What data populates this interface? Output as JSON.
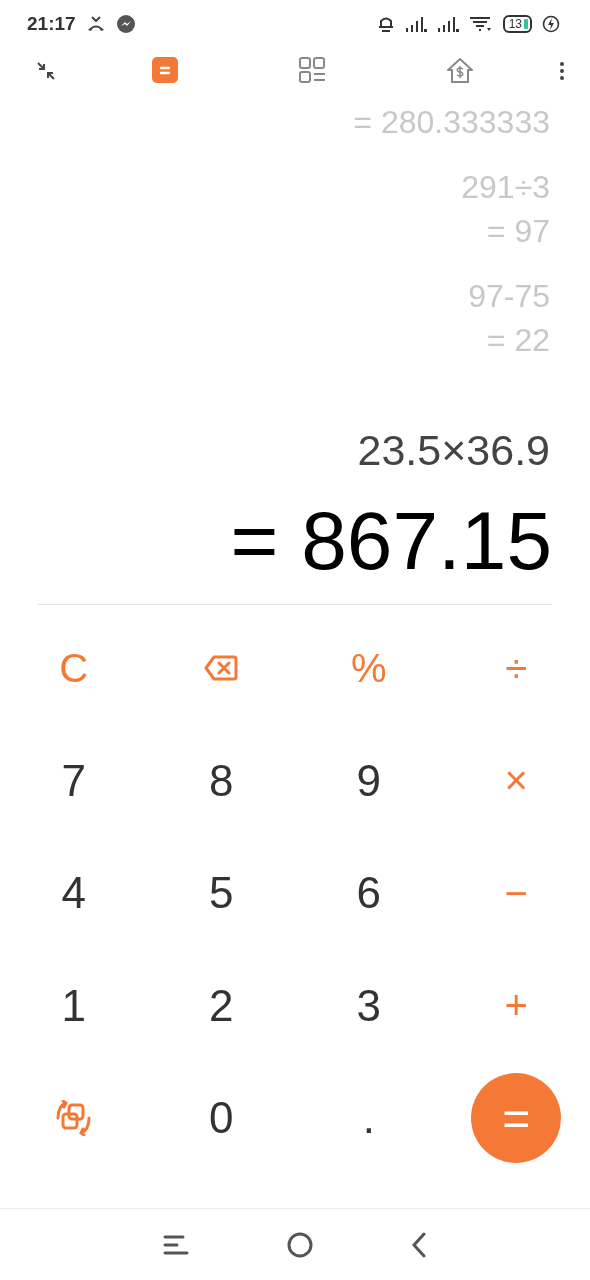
{
  "status_bar": {
    "time": "21:17",
    "battery": "13"
  },
  "toolbar": {
    "modes": [
      {
        "kind": "calculator",
        "selected": true
      },
      {
        "kind": "converter",
        "selected": false
      },
      {
        "kind": "mortgage",
        "selected": false
      }
    ]
  },
  "history": [
    {
      "result": "= 280.333333"
    },
    {
      "expression": "291÷3",
      "result": "= 97"
    },
    {
      "expression": "97-75",
      "result": "= 22"
    }
  ],
  "display": {
    "expression": "23.5×36.9",
    "result": "= 867.15"
  },
  "keys": [
    {
      "kind": "op",
      "label": "C"
    },
    {
      "kind": "backspace"
    },
    {
      "kind": "op",
      "label": "%"
    },
    {
      "kind": "op",
      "label": "÷"
    },
    {
      "kind": "digit",
      "label": "7"
    },
    {
      "kind": "digit",
      "label": "8"
    },
    {
      "kind": "digit",
      "label": "9"
    },
    {
      "kind": "op",
      "label": "×"
    },
    {
      "kind": "digit",
      "label": "4"
    },
    {
      "kind": "digit",
      "label": "5"
    },
    {
      "kind": "digit",
      "label": "6"
    },
    {
      "kind": "op",
      "label": "−"
    },
    {
      "kind": "digit",
      "label": "1"
    },
    {
      "kind": "digit",
      "label": "2"
    },
    {
      "kind": "digit",
      "label": "3"
    },
    {
      "kind": "op",
      "label": "+"
    },
    {
      "kind": "swap"
    },
    {
      "kind": "digit",
      "label": "0"
    },
    {
      "kind": "digit",
      "label": "."
    },
    {
      "kind": "equals",
      "label": "="
    }
  ]
}
